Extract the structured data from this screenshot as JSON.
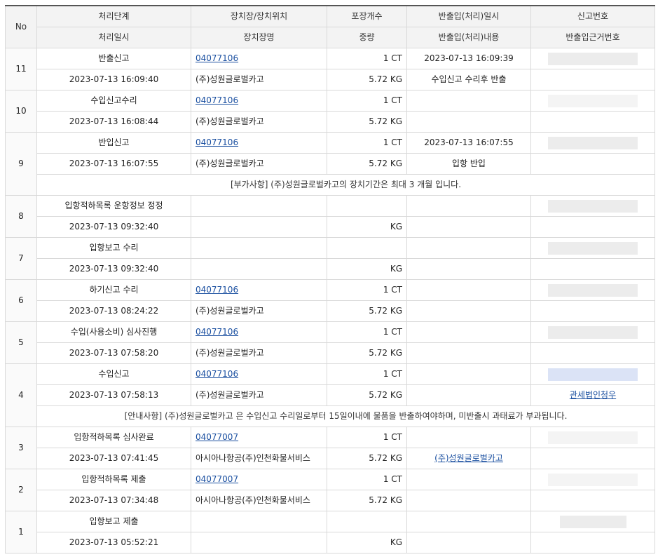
{
  "header": {
    "row1": [
      "No",
      "처리단계",
      "장치장/장치위치",
      "포장개수",
      "반출입(처리)일시",
      "신고번호"
    ],
    "row2": [
      "처리일시",
      "장치장명",
      "중량",
      "반출입(처리)내용",
      "반출입근거번호"
    ]
  },
  "rows": [
    {
      "no": "11",
      "stage": "반출신고",
      "loc": "04077106",
      "count": "1 CT",
      "io_time": "2023-07-13 16:09:39",
      "time": "2023-07-13 16:09:40",
      "name": "(주)성원글로벌카고",
      "weight": "5.72 KG",
      "io_desc": "수입신고 수리후 반출"
    },
    {
      "no": "10",
      "stage": "수입신고수리",
      "loc": "04077106",
      "count": "1 CT",
      "io_time": "",
      "time": "2023-07-13 16:08:44",
      "name": "(주)성원글로벌카고",
      "weight": "5.72 KG",
      "io_desc": ""
    },
    {
      "no": "9",
      "stage": "반입신고",
      "loc": "04077106",
      "count": "1 CT",
      "io_time": "2023-07-13 16:07:55",
      "time": "2023-07-13 16:07:55",
      "name": "(주)성원글로벌카고",
      "weight": "5.72 KG",
      "io_desc": "입항 반입",
      "note": "[부가사항] (주)성원글로벌카고의 장치기간은 최대 3 개월 입니다."
    },
    {
      "no": "8",
      "stage": "입항적하목록 운항정보 정정",
      "loc": "",
      "count": "",
      "io_time": "",
      "time": "2023-07-13 09:32:40",
      "name": "",
      "weight": "KG",
      "io_desc": ""
    },
    {
      "no": "7",
      "stage": "입항보고 수리",
      "loc": "",
      "count": "",
      "io_time": "",
      "time": "2023-07-13 09:32:40",
      "name": "",
      "weight": "KG",
      "io_desc": ""
    },
    {
      "no": "6",
      "stage": "하기신고 수리",
      "loc": "04077106",
      "count": "1 CT",
      "io_time": "",
      "time": "2023-07-13 08:24:22",
      "name": "(주)성원글로벌카고",
      "weight": "5.72 KG",
      "io_desc": ""
    },
    {
      "no": "5",
      "stage": "수입(사용소비) 심사진행",
      "loc": "04077106",
      "count": "1 CT",
      "io_time": "",
      "time": "2023-07-13 07:58:20",
      "name": "(주)성원글로벌카고",
      "weight": "5.72 KG",
      "io_desc": ""
    },
    {
      "no": "4",
      "stage": "수입신고",
      "loc": "04077106",
      "count": "1 CT",
      "io_time": "",
      "time": "2023-07-13 07:58:13",
      "name": "(주)성원글로벌카고",
      "weight": "5.72 KG",
      "io_desc": "",
      "ref": "관세법인청우",
      "note": "[안내사항] (주)성원글로벌카고 은 수입신고 수리일로부터 15일이내에 물품을 반출하여야하며, 미반출시 과태료가 부과됩니다."
    },
    {
      "no": "3",
      "stage": "입항적하목록 심사완료",
      "loc": "04077007",
      "count": "1 CT",
      "io_time": "",
      "time": "2023-07-13 07:41:45",
      "name": "아시아나항공(주)인천화물서비스",
      "weight": "5.72 KG",
      "io_desc": "(주)성원글로벌카고"
    },
    {
      "no": "2",
      "stage": "입항적하목록 제출",
      "loc": "04077007",
      "count": "1 CT",
      "io_time": "",
      "time": "2023-07-13 07:34:48",
      "name": "아시아나항공(주)인천화물서비스",
      "weight": "5.72 KG",
      "io_desc": ""
    },
    {
      "no": "1",
      "stage": "입항보고 제출",
      "loc": "",
      "count": "",
      "io_time": "",
      "time": "2023-07-13 05:52:21",
      "name": "",
      "weight": "KG",
      "io_desc": ""
    }
  ]
}
